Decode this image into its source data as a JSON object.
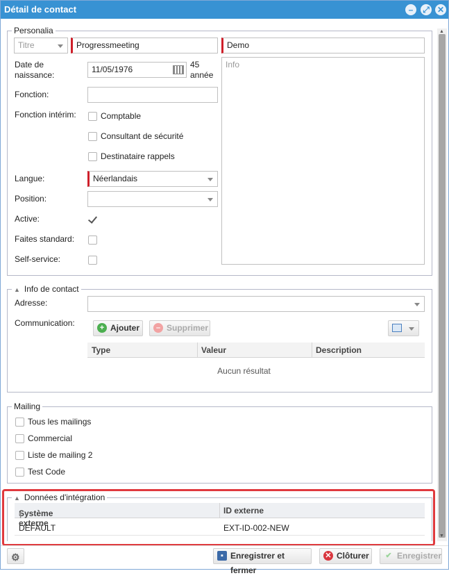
{
  "window": {
    "title": "Détail de contact"
  },
  "personalia": {
    "legend": "Personalia",
    "titre_placeholder": "Titre",
    "firstname": "Progressmeeting",
    "lastname": "Demo",
    "dob_label": "Date de naissance:",
    "dob_value": "11/05/1976",
    "age": "45 année",
    "info_placeholder": "Info",
    "fonction_label": "Fonction:",
    "interim_label": "Fonction intérim:",
    "interim_options": [
      "Comptable",
      "Consultant de sécurité",
      "Destinataire rappels"
    ],
    "langue_label": "Langue:",
    "langue_value": "Néerlandais",
    "position_label": "Position:",
    "active_label": "Active:",
    "standard_label": "Faites standard:",
    "selfservice_label": "Self-service:"
  },
  "contact": {
    "legend": "Info de contact",
    "adresse_label": "Adresse:",
    "communication_label": "Communication:",
    "add_label": "Ajouter",
    "delete_label": "Supprimer",
    "columns": [
      "Type",
      "Valeur",
      "Description"
    ],
    "empty": "Aucun résultat"
  },
  "mailing": {
    "legend": "Mailing",
    "items": [
      "Tous les mailings",
      "Commercial",
      "Liste de mailing 2",
      "Test Code"
    ]
  },
  "integration": {
    "legend": "Données d'intégration",
    "columns": [
      "Système externe",
      "ID externe"
    ],
    "rows": [
      {
        "system": "DEFAULT",
        "id": "EXT-ID-002-NEW"
      }
    ]
  },
  "footer": {
    "save_close": "Enregistrer et fermer",
    "close": "Clôturer",
    "save": "Enregistrer"
  },
  "colors": {
    "titlebar": "#3892d3",
    "required": "#cf1f2a",
    "highlight": "#e03a3e"
  }
}
